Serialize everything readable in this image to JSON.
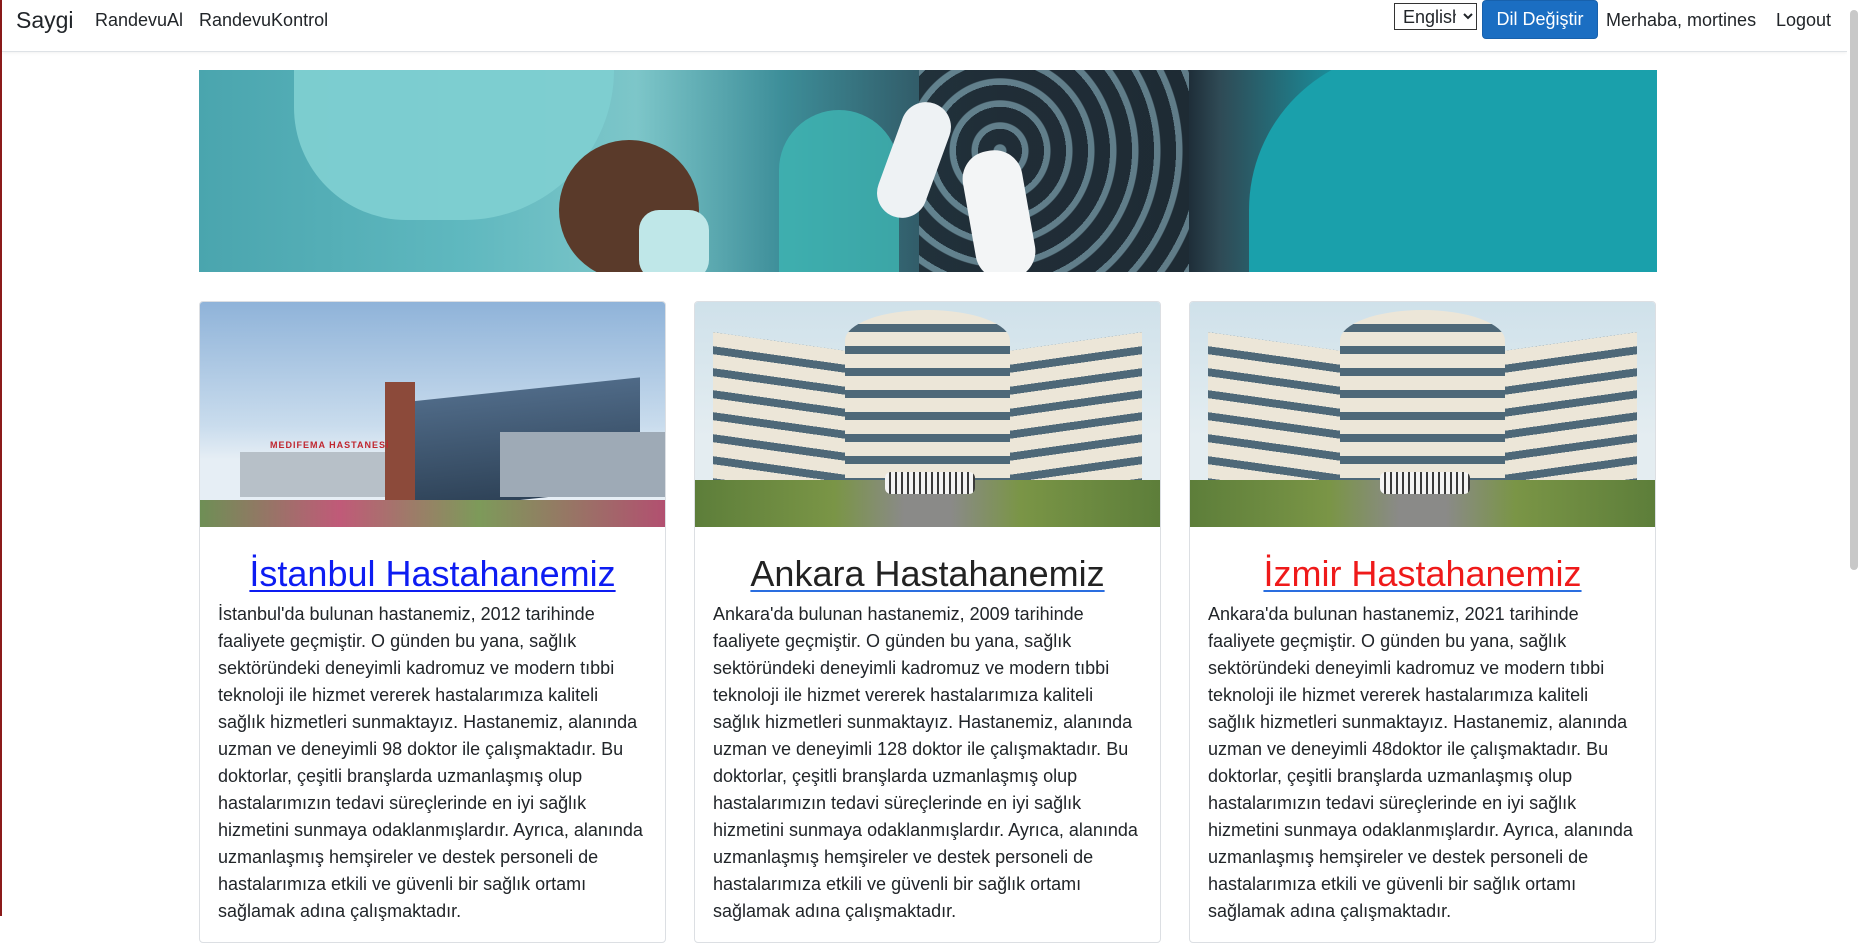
{
  "navbar": {
    "brand": "Saygi",
    "links": [
      "RandevuAl",
      "RandevuKontrol"
    ],
    "language_selected": "English",
    "language_button": "Dil Değiştir",
    "greeting": "Merhaba, mortines",
    "logout": "Logout"
  },
  "cards": [
    {
      "title": "İstanbul Hastahanemiz",
      "title_color": "#0d1cf2",
      "text": "İstanbul'da bulunan hastanemiz, 2012 tarihinde faaliyete geçmiştir. O günden bu yana, sağlık sektöründeki deneyimli kadromuz ve modern tıbbi teknoloji ile hizmet vererek hastalarımıza kaliteli sağlık hizmetleri sunmaktayız. Hastanemiz, alanında uzman ve deneyimli 98 doktor ile çalışmaktadır. Bu doktorlar, çeşitli branşlarda uzmanlaşmış olup hastalarımızın tedavi süreçlerinde en iyi sağlık hizmetini sunmaya odaklanmışlardır. Ayrıca, alanında uzmanlaşmış hemşireler ve destek personeli de hastalarımıza etkili ve güvenli bir sağlık ortamı sağlamak adına çalışmaktadır."
    },
    {
      "title": "Ankara Hastahanemiz",
      "title_color": "#222222",
      "text": "Ankara'da bulunan hastanemiz, 2009 tarihinde faaliyete geçmiştir. O günden bu yana, sağlık sektöründeki deneyimli kadromuz ve modern tıbbi teknoloji ile hizmet vererek hastalarımıza kaliteli sağlık hizmetleri sunmaktayız. Hastanemiz, alanında uzman ve deneyimli 128 doktor ile çalışmaktadır. Bu doktorlar, çeşitli branşlarda uzmanlaşmış olup hastalarımızın tedavi süreçlerinde en iyi sağlık hizmetini sunmaya odaklanmışlardır. Ayrıca, alanında uzmanlaşmış hemşireler ve destek personeli de hastalarımıza etkili ve güvenli bir sağlık ortamı sağlamak adına çalışmaktadır."
    },
    {
      "title": "İzmir Hastahanemiz",
      "title_color": "#ef1a1a",
      "text": "Ankara'da bulunan hastanemiz, 2021 tarihinde faaliyete geçmiştir. O günden bu yana, sağlık sektöründeki deneyimli kadromuz ve modern tıbbi teknoloji ile hizmet vererek hastalarımıza kaliteli sağlık hizmetleri sunmaktayız. Hastanemiz, alanında uzman ve deneyimli 48doktor ile çalışmaktadır. Bu doktorlar, çeşitli branşlarda uzmanlaşmış olup hastalarımızın tedavi süreçlerinde en iyi sağlık hizmetini sunmaya odaklanmışlardır. Ayrıca, alanında uzmanlaşmış hemşireler ve destek personeli de hastalarımıza etkili ve güvenli bir sağlık ortamı sağlamak adına çalışmaktadır."
    }
  ],
  "images": {
    "istanbul_sign": "MEDIFEMA HASTANESİ"
  },
  "colors": {
    "primary_button": "#1b6ec2",
    "link_blue": "#0d1cf2",
    "link_red": "#ef1a1a"
  }
}
